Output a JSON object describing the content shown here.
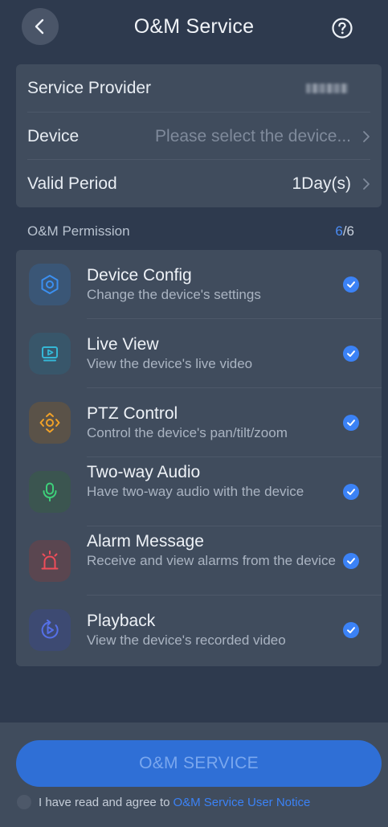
{
  "header": {
    "title": "O&M Service",
    "back_icon": "chevron-left-icon",
    "help_icon": "question-circle-icon"
  },
  "info": {
    "service_provider_label": "Service Provider",
    "device_label": "Device",
    "device_placeholder": "Please select the device...",
    "valid_period_label": "Valid Period",
    "valid_period_value": "1Day(s)"
  },
  "permissions": {
    "title": "O&M Permission",
    "selected": "6",
    "total": "/6",
    "items": [
      {
        "name": "Device Config",
        "desc": "Change the device's settings",
        "icon": "settings-hexagon-icon",
        "checked": true
      },
      {
        "name": "Live View",
        "desc": "View the device's live video",
        "icon": "live-view-icon",
        "checked": true
      },
      {
        "name": "PTZ Control",
        "desc": "Control the device's pan/tilt/zoom",
        "icon": "ptz-arrows-icon",
        "checked": true
      },
      {
        "name": "Two-way Audio",
        "desc": "Have two-way audio with the device",
        "icon": "microphone-icon",
        "checked": true
      },
      {
        "name": "Alarm Message",
        "desc": "Receive and view alarms from the device",
        "icon": "alarm-siren-icon",
        "checked": true
      },
      {
        "name": "Playback",
        "desc": "View the device's recorded video",
        "icon": "playback-icon",
        "checked": true
      }
    ]
  },
  "footer": {
    "button_label": "O&M SERVICE",
    "agree_text": "I have read and agree to",
    "agree_link": "O&M Service User Notice"
  },
  "colors": {
    "background": "#2e3a4e",
    "card": "#404c5d",
    "accent": "#3b82f6"
  }
}
